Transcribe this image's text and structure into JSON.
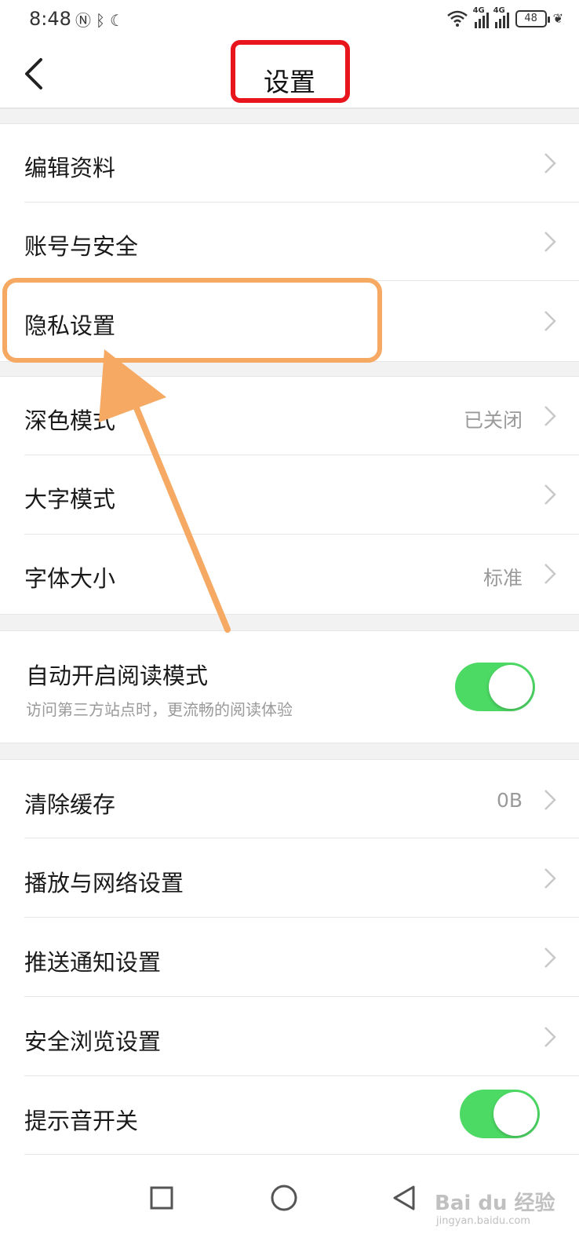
{
  "status_bar": {
    "time": "8:48",
    "battery": "48",
    "network_label": "4G"
  },
  "header": {
    "title": "设置",
    "back_icon": "chevron-left-icon"
  },
  "groups": [
    {
      "items": [
        {
          "label": "编辑资料",
          "value": ""
        },
        {
          "label": "账号与安全",
          "value": ""
        },
        {
          "label": "隐私设置",
          "value": ""
        }
      ]
    },
    {
      "items": [
        {
          "label": "深色模式",
          "value": "已关闭"
        },
        {
          "label": "大字模式",
          "value": ""
        },
        {
          "label": "字体大小",
          "value": "标准"
        }
      ]
    },
    {
      "items": [
        {
          "label": "自动开启阅读模式",
          "sublabel": "访问第三方站点时，更流畅的阅读体验",
          "toggle": true
        }
      ]
    },
    {
      "items": [
        {
          "label": "清除缓存",
          "value": "0B"
        },
        {
          "label": "播放与网络设置",
          "value": ""
        },
        {
          "label": "推送通知设置",
          "value": ""
        },
        {
          "label": "安全浏览设置",
          "value": ""
        },
        {
          "label": "提示音开关",
          "toggle": true
        }
      ]
    }
  ],
  "colors": {
    "toggle_on": "#4cd964",
    "title_highlight": "#e8151c",
    "annotation": "#f5a962",
    "group_gap": "#f2f2f2"
  },
  "watermark": {
    "text": "Bai du 经验",
    "sub": "jingyan.baidu.com"
  }
}
